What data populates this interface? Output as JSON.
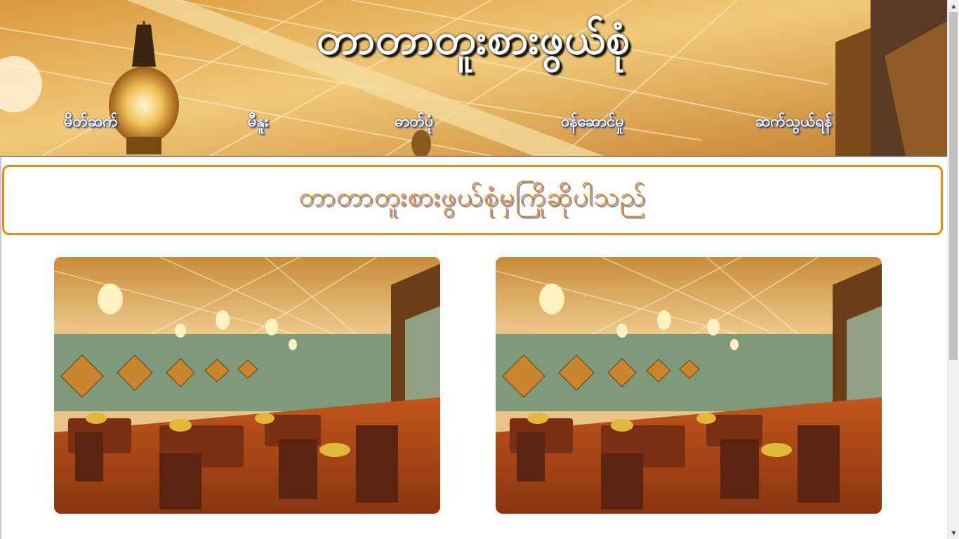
{
  "header": {
    "title": "တာတာတူးစားဖွယ်စုံ"
  },
  "nav": {
    "items": [
      {
        "label": "မိတ်ဆက်"
      },
      {
        "label": "မီနူး"
      },
      {
        "label": "ဓာတ်ပုံ"
      },
      {
        "label": "ဝန်ဆောင်မှု"
      },
      {
        "label": "ဆက်သွယ်ရန်"
      }
    ]
  },
  "welcome": {
    "text": "တာတာတူးစားဖွယ်စုံမှကြိုဆိုပါသည်"
  },
  "gallery": {
    "images": [
      {
        "icon": "restaurant-interior-photo"
      },
      {
        "icon": "restaurant-interior-photo"
      }
    ]
  },
  "colors": {
    "accent": "#ee8a10",
    "title_shadow": "#5b78c7",
    "nav_text": "#ffffff"
  }
}
